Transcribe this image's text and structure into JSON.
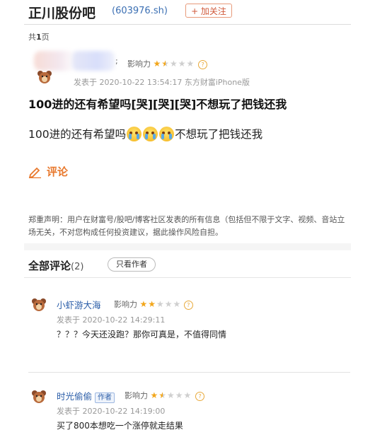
{
  "header": {
    "title": "正川股份吧",
    "code": "(603976.sh)",
    "follow_label": "+ 加关注"
  },
  "page_info": {
    "prefix": "共",
    "num": "1",
    "suffix": "页"
  },
  "post": {
    "influence_label": "影响力",
    "stars": "★★★★★",
    "rating": 1.5,
    "meta": "发表于 2020-10-22 13:54:17 东方财富iPhone版",
    "title": "100进的还有希望吗[哭][哭][哭]不想玩了把钱还我",
    "body_before": "100进的还有希望吗",
    "body_after": "不想玩了把钱还我",
    "emoji_icons": [
      "crying-emoji-icon",
      "crying-emoji-icon",
      "crying-emoji-icon"
    ]
  },
  "comment_link": {
    "label": "评论"
  },
  "disclaimer": "郑重声明：用户在财富号/股吧/博客社区发表的所有信息（包括但不限于文字、视频、音站立场无关，不对您构成任何投资建议，据此操作风险自担。",
  "comments_section": {
    "title": "全部评论",
    "count": "(2)",
    "only_author_label": "只看作者"
  },
  "comments": [
    {
      "username": "小虾游大海",
      "influence_label": "影响力",
      "stars": "★★★★★",
      "rating": 2,
      "meta": "发表于 2020-10-22 14:29:11",
      "text": "？？？今天还没跑？那你可真是，不值得同情"
    },
    {
      "username": "时光偷偷",
      "author_badge": "作者",
      "influence_label": "影响力",
      "stars": "★★★★★",
      "rating": 1.5,
      "meta": "发表于 2020-10-22 14:19:00",
      "text": "买了800本想吃一个涨停就走结果"
    }
  ],
  "colors": {
    "accent_orange": "#e8782c",
    "link_blue": "#2a5da8",
    "star": "#f2a61b"
  }
}
